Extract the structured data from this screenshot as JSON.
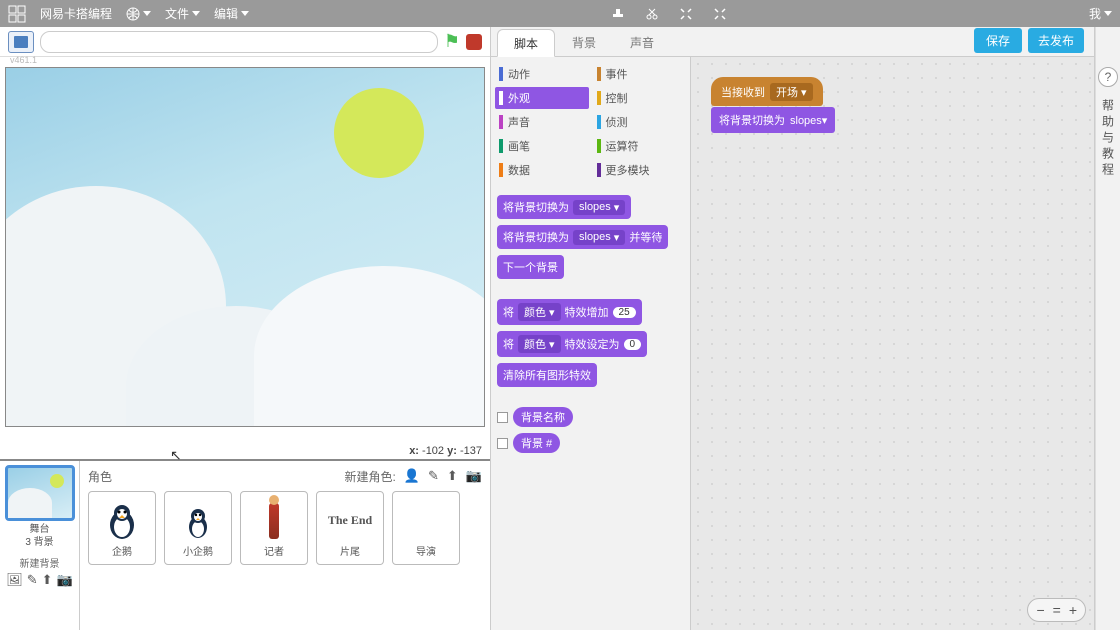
{
  "topbar": {
    "brand": "网易卡搭编程",
    "menu_file": "文件",
    "menu_edit": "编辑",
    "menu_user": "我"
  },
  "stage": {
    "version": "v461.1",
    "x_label": "x:",
    "x_val": "-102",
    "y_label": "y:",
    "y_val": "-137"
  },
  "stage_thumb": {
    "title": "舞台",
    "sub": "3 背景",
    "newbg": "新建背景"
  },
  "sprites": {
    "header": "角色",
    "new_label": "新建角色:",
    "items": [
      {
        "name": "企鹅"
      },
      {
        "name": "小企鹅"
      },
      {
        "name": "记者"
      },
      {
        "name": "片尾",
        "text": "The End"
      },
      {
        "name": "导演"
      }
    ]
  },
  "tabs": {
    "scripts": "脚本",
    "backdrops": "背景",
    "sounds": "声音"
  },
  "buttons": {
    "save": "保存",
    "publish": "去发布"
  },
  "categories": {
    "motion": "动作",
    "looks": "外观",
    "sound": "声音",
    "pen": "画笔",
    "data": "数据",
    "events": "事件",
    "control": "控制",
    "sensing": "侦测",
    "operators": "运算符",
    "more": "更多模块"
  },
  "palette_blocks": {
    "b1_a": "将背景切换为",
    "b1_dd": "slopes",
    "b2_a": "将背景切换为",
    "b2_dd": "slopes",
    "b2_b": "并等待",
    "b3": "下一个背景",
    "b4_a": "将",
    "b4_dd": "颜色",
    "b4_b": "特效增加",
    "b4_n": "25",
    "b5_a": "将",
    "b5_dd": "颜色",
    "b5_b": "特效设定为",
    "b5_n": "0",
    "b6": "清除所有图形特效",
    "r1": "背景名称",
    "r2": "背景 #"
  },
  "script_blocks": {
    "hat_a": "当接收到",
    "hat_dd": "开场",
    "s1_a": "将背景切换为",
    "s1_dd": "slopes"
  },
  "help": {
    "q": "?",
    "text": "帮助与教程"
  }
}
